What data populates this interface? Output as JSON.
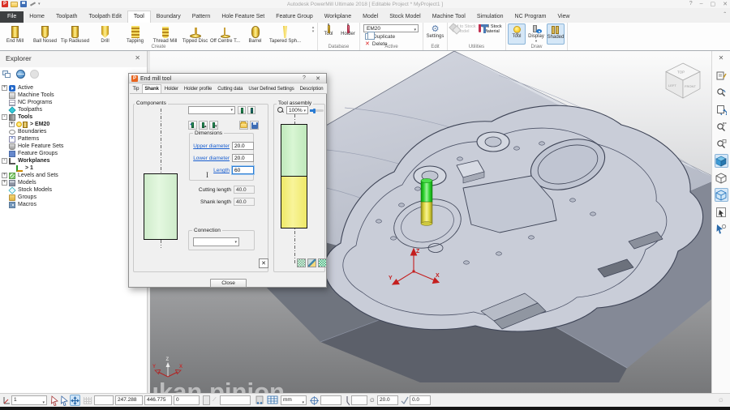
{
  "window": {
    "title": "Autodesk PowerMill Ultimate 2018   [ Editable Project * MyProject1 ]",
    "help": "?",
    "minimize": "–",
    "maximize": "▢",
    "close": "✕"
  },
  "ribbon": {
    "tabs": [
      {
        "label": "File",
        "dark": true
      },
      {
        "label": "Home"
      },
      {
        "label": "Toolpath"
      },
      {
        "label": "Toolpath Edit"
      },
      {
        "label": "Tool",
        "active": true
      },
      {
        "label": "Boundary"
      },
      {
        "label": "Pattern"
      },
      {
        "label": "Hole Feature Set"
      },
      {
        "label": "Feature Group"
      },
      {
        "label": "Workplane"
      },
      {
        "label": "Model"
      },
      {
        "label": "Stock Model"
      },
      {
        "label": "Machine Tool"
      },
      {
        "label": "Simulation"
      },
      {
        "label": "NC Program"
      },
      {
        "label": "View"
      }
    ],
    "create": {
      "label": "Create",
      "tools": [
        {
          "label": "End Mill",
          "shape": "endmill"
        },
        {
          "label": "Ball Nosed",
          "shape": "ballnosed"
        },
        {
          "label": "Tip Radiused",
          "shape": "tipradiused"
        },
        {
          "label": "Drill",
          "shape": "drill"
        },
        {
          "label": "Tapping",
          "shape": "tapping"
        },
        {
          "label": "Thread Mill",
          "shape": "threadmill"
        },
        {
          "label": "Tipped Disc",
          "shape": "tippeddisc"
        },
        {
          "label": "Off Centre T...",
          "shape": "offcentre"
        },
        {
          "label": "Barrel",
          "shape": "barrel"
        },
        {
          "label": "Tapered Sph...",
          "shape": "tapered"
        }
      ]
    },
    "database": {
      "label": "Database",
      "tool": "Tool",
      "holder": "Holder"
    },
    "active": {
      "label": "Active",
      "tool_name": "EM20",
      "duplicate": "Duplicate",
      "delete": "Delete"
    },
    "edit": {
      "label": "Edit",
      "settings": "Settings"
    },
    "utilities": {
      "label": "Utilities",
      "add_to_stock": "Add to Stock Model",
      "tool_stock": "Tool Stock Material"
    },
    "draw": {
      "label": "Draw",
      "tool": "Tool",
      "display": "Display",
      "shaded": "Shaded"
    }
  },
  "explorer": {
    "title": "Explorer",
    "close": "✕",
    "items": [
      {
        "label": "Active",
        "icon": "active",
        "level": 0,
        "expand": "+"
      },
      {
        "label": "Machine Tools",
        "icon": "machine-tools",
        "level": 0
      },
      {
        "label": "NC Programs",
        "icon": "nc-programs",
        "level": 0
      },
      {
        "label": "Toolpaths",
        "icon": "toolpaths",
        "level": 0
      },
      {
        "label": "Tools",
        "icon": "tools",
        "level": 0,
        "expand": "-",
        "bold": true
      },
      {
        "label": "> EM20",
        "icon": "em20",
        "level": 1,
        "expand": "+",
        "bold": true
      },
      {
        "label": "Boundaries",
        "icon": "boundaries",
        "level": 0
      },
      {
        "label": "Patterns",
        "icon": "patterns",
        "level": 0
      },
      {
        "label": "Hole Feature Sets",
        "icon": "hole-feature-sets",
        "level": 0
      },
      {
        "label": "Feature Groups",
        "icon": "feature-groups",
        "level": 0
      },
      {
        "label": "Workplanes",
        "icon": "workplanes",
        "level": 0,
        "expand": "-",
        "bold": true
      },
      {
        "label": "> 1",
        "icon": "workplane-1",
        "level": 1,
        "bold": true
      },
      {
        "label": "Levels and Sets",
        "icon": "levels",
        "level": 0,
        "expand": "+"
      },
      {
        "label": "Models",
        "icon": "models",
        "level": 0,
        "expand": "+"
      },
      {
        "label": "Stock Models",
        "icon": "stock-models",
        "level": 0
      },
      {
        "label": "Groups",
        "icon": "groups",
        "level": 0
      },
      {
        "label": "Macros",
        "icon": "macros",
        "level": 0
      }
    ]
  },
  "dialog": {
    "title": "End mill tool",
    "help": "?",
    "close_icon": "✕",
    "tabs": [
      "Tip",
      "Shank",
      "Holder",
      "Holder profile",
      "Cutting data",
      "User Defined Settings",
      "Description"
    ],
    "active_tab": "Shank",
    "components_label": "Components",
    "assembly_label": "Tool assembly",
    "zoom_value": "100%",
    "dimensions_label": "Dimensions",
    "upper_label": "Upper diameter",
    "upper_value": "20.0",
    "lower_label": "Lower diameter",
    "lower_value": "20.0",
    "length_label": "Length",
    "length_value": "60",
    "cutting_label": "Cutting length",
    "cutting_value": "40.0",
    "shank_label": "Shank length",
    "shank_value": "40.0",
    "connection_label": "Connection",
    "close_label": "Close"
  },
  "viewport": {
    "watermark": "ukan pinion",
    "viewcube": {
      "top": "TOP",
      "left": "LEFT",
      "front": "FRONT"
    },
    "axis_labels": {
      "x": "X",
      "y": "Y",
      "z": "Z"
    },
    "colors": {
      "tool_shank": "#2fd42f",
      "tool_cutter": "#e8e23e",
      "model_top": "#c2c7d2",
      "axis": "#c41e1e"
    }
  },
  "view_toolbar": {
    "icons": [
      {
        "name": "view-sheet-icon"
      },
      {
        "name": "zoom-previous-icon"
      },
      {
        "name": "refresh-view-icon"
      },
      {
        "name": "zoom-selection-icon"
      },
      {
        "name": "zoom-window-icon"
      },
      {
        "name": "shaded-view-icon",
        "active": true
      },
      {
        "name": "wireframe-view-icon"
      },
      {
        "name": "shaded-wireframe-view-icon",
        "active": true
      },
      {
        "name": "box-select-icon"
      },
      {
        "name": "rotate-view-icon"
      }
    ]
  },
  "status": {
    "workplane": "1",
    "x": "247.288",
    "y": "446.775",
    "z": "0",
    "units": "mm",
    "diameter_symbol": "∅",
    "diameter": "20.0",
    "tip_radius": "0.0"
  }
}
